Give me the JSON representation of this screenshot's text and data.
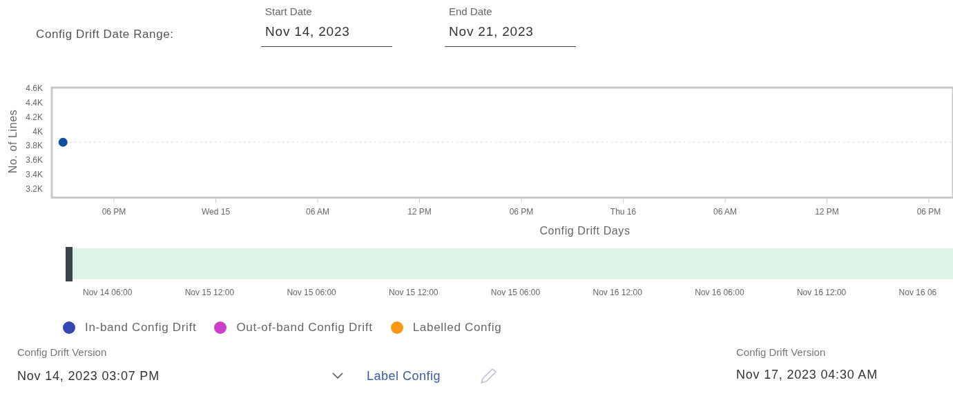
{
  "date_range": {
    "label": "Config Drift Date Range:",
    "start": {
      "label": "Start Date",
      "value": "Nov 14, 2023"
    },
    "end": {
      "label": "End Date",
      "value": "Nov 21, 2023"
    }
  },
  "chart": {
    "chart_data": {
      "type": "scatter",
      "xlabel": "Config Drift Days",
      "ylabel": "No. of Lines",
      "categories": [
        null,
        "06 PM",
        null,
        "Wed 15",
        null,
        "06 AM",
        null,
        "12 PM",
        null,
        "06 PM",
        null,
        "Thu 16",
        null,
        "06 AM",
        null,
        "12 PM",
        null,
        "06 PM"
      ],
      "series": [
        {
          "color": "#0d4fa0",
          "values": [
            3850,
            null,
            null,
            null,
            null,
            null,
            null,
            null,
            null,
            null,
            null,
            null,
            null,
            null,
            null,
            null,
            null,
            null
          ]
        }
      ],
      "ref_lines": [
        {
          "axis": "y",
          "value": 3850
        }
      ],
      "ylim": [
        3100,
        4600
      ],
      "yticks": [
        {
          "value": 3200,
          "label": "3.2K"
        },
        {
          "value": 3400,
          "label": "3.4K"
        },
        {
          "value": 3600,
          "label": "3.6K"
        },
        {
          "value": 3800,
          "label": "3.8K"
        },
        {
          "value": 4000,
          "label": "4K"
        },
        {
          "value": 4200,
          "label": "4.2K"
        },
        {
          "value": 4400,
          "label": "4.4K"
        },
        {
          "value": 4600,
          "label": "4.6K"
        }
      ]
    }
  },
  "navigator": {
    "labels": [
      "Nov 14 06:00",
      "Nov 15 12:00",
      "Nov 15 06:00",
      "Nov 15 12:00",
      "Nov 15 06:00",
      "Nov 16 12:00",
      "Nov 16 06:00",
      "Nov 16 12:00",
      "Nov 16 06"
    ]
  },
  "legend": [
    {
      "label": "In-band Config Drift",
      "color": "#3346b4"
    },
    {
      "label": "Out-of-band Config Drift",
      "color": "#cc3fc8"
    },
    {
      "label": "Labelled Config",
      "color": "#f59a12"
    }
  ],
  "version_left": {
    "label": "Config Drift Version",
    "value": "Nov 14, 2023 03:07 PM"
  },
  "label_config_link": "Label Config",
  "version_right": {
    "label": "Config Drift Version",
    "value": "Nov 17, 2023 04:30 AM"
  }
}
